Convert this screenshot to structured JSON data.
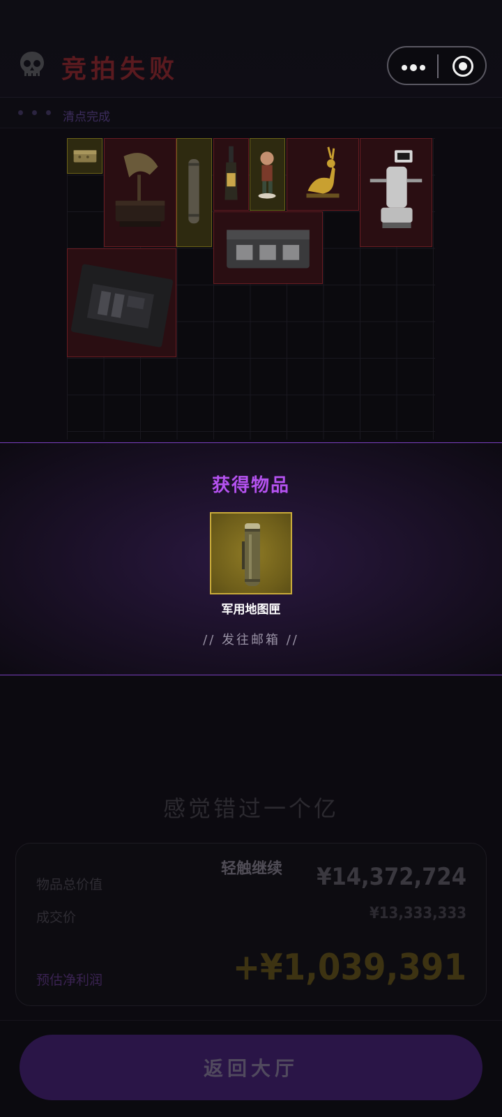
{
  "header": {
    "title": "竞拍失败",
    "skull_icon": "skull-icon",
    "menu_icon": "more-dots-icon",
    "close_icon": "target-circle-icon"
  },
  "progress": {
    "label": "清点完成",
    "dot_color": "#2b2440"
  },
  "inventory": {
    "items": [
      {
        "name": "small-box",
        "rarity": "gold"
      },
      {
        "name": "gramophone",
        "rarity": "red"
      },
      {
        "name": "map-tube",
        "rarity": "gold"
      },
      {
        "name": "champagne-bottle",
        "rarity": "red"
      },
      {
        "name": "figurine",
        "rarity": "gold"
      },
      {
        "name": "golden-deer",
        "rarity": "red"
      },
      {
        "name": "robot",
        "rarity": "red"
      },
      {
        "name": "ammo-crate",
        "rarity": "red"
      },
      {
        "name": "equipment-case",
        "rarity": "red"
      }
    ]
  },
  "reward": {
    "title": "获得物品",
    "item_name": "军用地图匣",
    "note": "// 发往邮箱 //",
    "accent_color": "#b552f0"
  },
  "result": {
    "slogan": "感觉错过一个亿",
    "tap_continue": "轻触继续",
    "total_label": "物品总价值",
    "total_value": "¥14,372,724",
    "deal_label": "成交价",
    "deal_value": "¥13,333,333",
    "profit_label": "预估净利润",
    "profit_value": "+¥1,039,391"
  },
  "footer": {
    "back_label": "返回大厅"
  }
}
